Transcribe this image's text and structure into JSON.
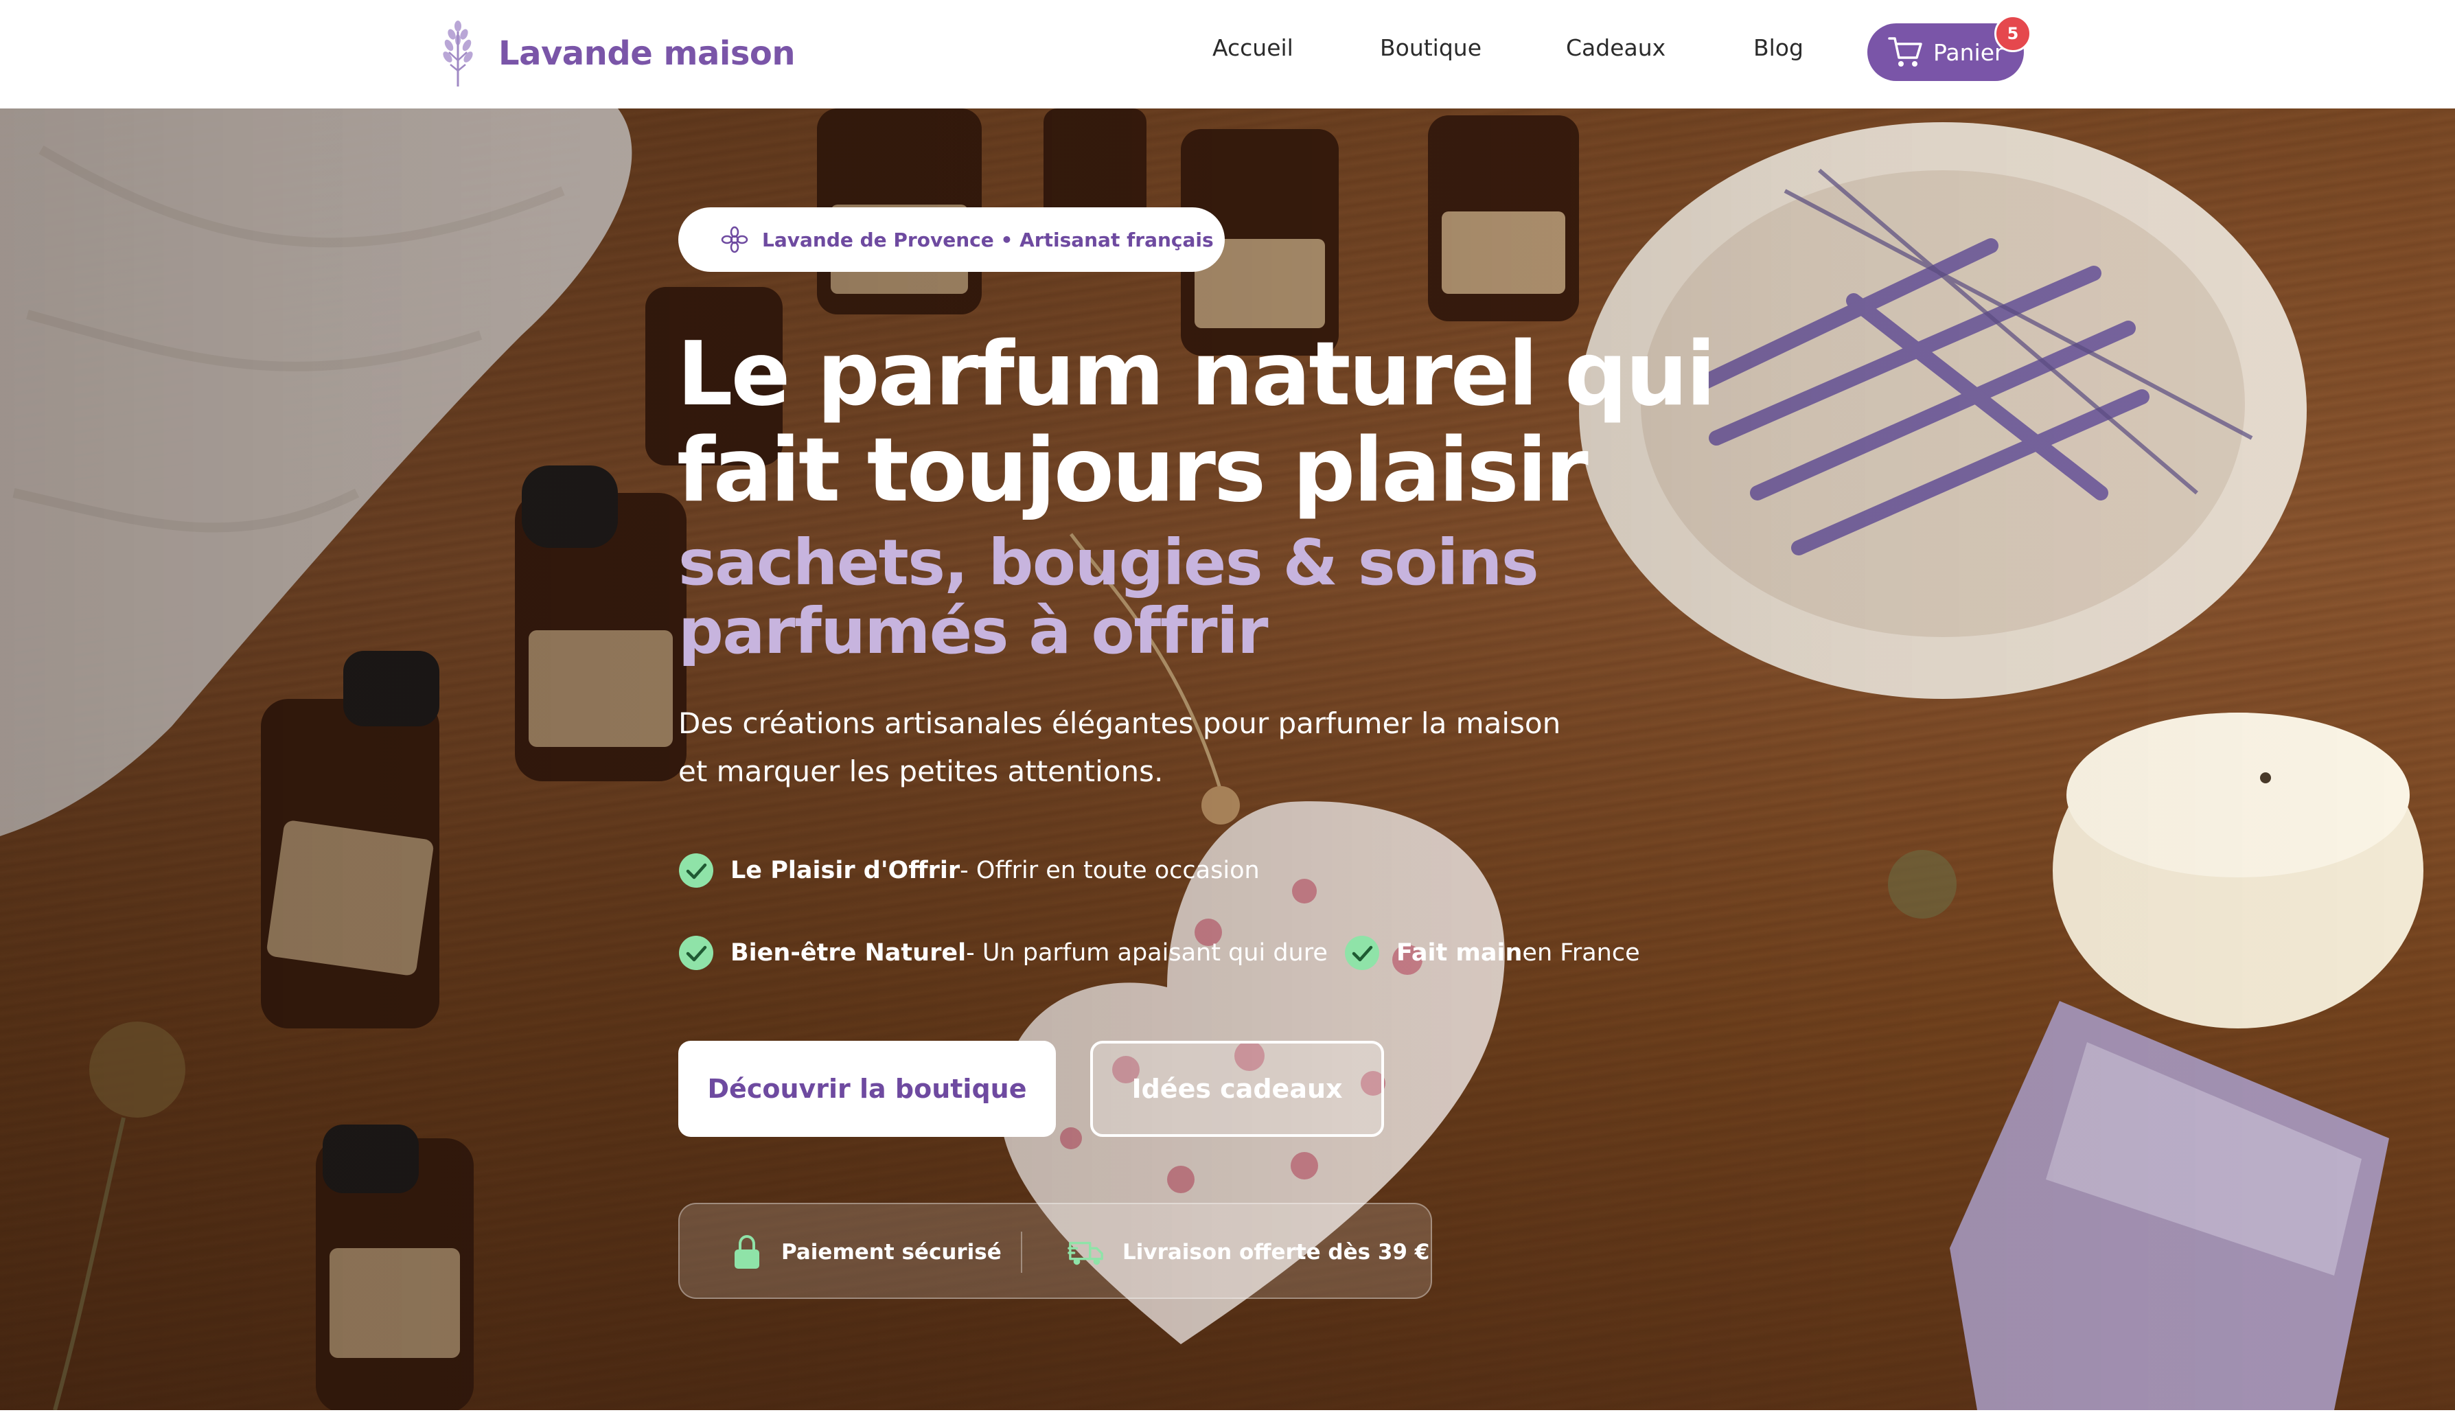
{
  "brand": {
    "name": "Lavande maison",
    "accent": "#7a55a8",
    "logo_icon": "lavender-sprig-icon"
  },
  "nav": {
    "items": [
      {
        "label": "Accueil"
      },
      {
        "label": "Boutique"
      },
      {
        "label": "Cadeaux"
      },
      {
        "label": "Blog"
      }
    ],
    "cart": {
      "label": "Panier",
      "count": "5",
      "icon": "cart-icon"
    }
  },
  "hero": {
    "badge": {
      "text": "Lavande de Provence • Artisanat français",
      "icon": "flower-icon"
    },
    "title_line1": "Le parfum naturel qui",
    "title_line2": "fait toujours plaisir",
    "subtitle_line1": "sachets, bougies & soins",
    "subtitle_line2": "parfumés à offrir",
    "lead_line1": "Des créations artisanales élégantes pour parfumer la maison",
    "lead_line2": "et marquer les petites attentions.",
    "features": [
      {
        "title": "Le Plaisir d'Offrir",
        "text": " - Offrir en toute occasion",
        "icon": "check-circle-icon"
      },
      {
        "title": "Bien-être Naturel",
        "text": " - Un parfum apaisant qui dure",
        "icon": "check-circle-icon"
      },
      {
        "title": "Fait main",
        "text": " en France",
        "icon": "check-circle-icon"
      }
    ],
    "cta_primary": "Découvrir la boutique",
    "cta_secondary": "Idées cadeaux",
    "trust": [
      {
        "text": "Paiement sécurisé",
        "icon": "lock-icon"
      },
      {
        "text": "Livraison offerte dès 39 €",
        "icon": "delivery-truck-icon"
      }
    ],
    "check_color": "#8fe3a8",
    "subtitle_color": "#c7b4de"
  }
}
